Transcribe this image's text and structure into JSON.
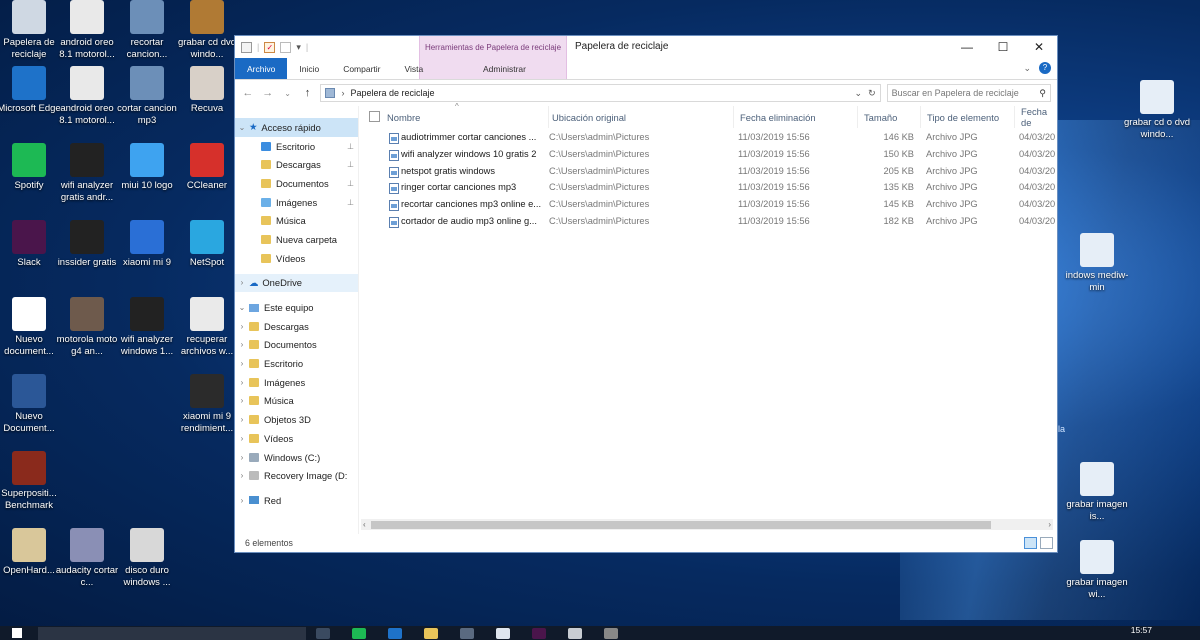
{
  "desktop": {
    "icons": [
      {
        "label": "Papelera de reciclaje",
        "icon": "recycle-bin-icon",
        "color": "#cfd8e3"
      },
      {
        "label": "android oreo 8.1 motorol...",
        "icon": "document-icon",
        "color": "#e9e9e9"
      },
      {
        "label": "recortar cancion...",
        "icon": "image-icon",
        "color": "#6c8fb8"
      },
      {
        "label": "grabar cd dvd windo...",
        "icon": "image-icon",
        "color": "#b07a34"
      },
      {
        "label": "Microsoft Edge",
        "icon": "edge-icon",
        "color": "#1e72c9"
      },
      {
        "label": "android oreo 8.1 motorol...",
        "icon": "document-icon",
        "color": "#e9e9e9"
      },
      {
        "label": "cortar cancion mp3",
        "icon": "image-icon",
        "color": "#6c8fb8"
      },
      {
        "label": "Recuva",
        "icon": "recuva-icon",
        "color": "#d8d0c8"
      },
      {
        "label": "Spotify",
        "icon": "spotify-icon",
        "color": "#1db954"
      },
      {
        "label": "wifi analyzer gratis andr...",
        "icon": "image-icon",
        "color": "#222"
      },
      {
        "label": "miui 10 logo",
        "icon": "image-icon",
        "color": "#3ea3f0"
      },
      {
        "label": "CCleaner",
        "icon": "ccleaner-icon",
        "color": "#d6302b"
      },
      {
        "label": "Slack",
        "icon": "slack-icon",
        "color": "#4a154b"
      },
      {
        "label": "inssider gratis",
        "icon": "image-icon",
        "color": "#222"
      },
      {
        "label": "xiaomi mi 9",
        "icon": "image-icon",
        "color": "#2a6fd6"
      },
      {
        "label": "NetSpot",
        "icon": "netspot-icon",
        "color": "#2aa7e0"
      },
      {
        "label": "Nuevo document...",
        "icon": "document-icon",
        "color": "#ffffff"
      },
      {
        "label": "motorola moto g4 an...",
        "icon": "image-icon",
        "color": "#6e5a4c"
      },
      {
        "label": "wifi analyzer windows 1...",
        "icon": "image-icon",
        "color": "#222"
      },
      {
        "label": "recuperar archivos w...",
        "icon": "image-icon",
        "color": "#eaeaea"
      },
      {
        "label": "Nuevo Document...",
        "icon": "word-icon",
        "color": "#2b5797"
      },
      {
        "label": "xiaomi mi 9 rendimient...",
        "icon": "image-icon",
        "color": "#2b2b2b"
      },
      {
        "label": "Superpositi... Benchmark",
        "icon": "benchmark-icon",
        "color": "#8a2a1c"
      },
      {
        "label": "OpenHard...",
        "icon": "openhardware-icon",
        "color": "#d9c79a"
      },
      {
        "label": "audacity cortar c...",
        "icon": "image-icon",
        "color": "#8a8fb5"
      },
      {
        "label": "disco duro windows ...",
        "icon": "image-icon",
        "color": "#d8d8d8"
      },
      {
        "label": "grabar cd o dvd windo...",
        "icon": "image-icon",
        "color": "#e6eef7"
      },
      {
        "label": "indows mediw-min",
        "icon": "image-icon",
        "color": "#e6eef7"
      },
      {
        "label": "grabar imagen is...",
        "icon": "image-icon",
        "color": "#e6eef7"
      },
      {
        "label": "grabar imagen wi...",
        "icon": "image-icon",
        "color": "#e6eef7"
      }
    ],
    "edge_text": "la"
  },
  "window": {
    "title": "Papelera de reciclaje",
    "contextual_tab_title": "Herramientas de Papelera de reciclaje",
    "controls": {
      "minimize": "—",
      "maximize": "☐",
      "close": "✕"
    },
    "ribbon_tabs": [
      "Archivo",
      "Inicio",
      "Compartir",
      "Vista"
    ],
    "admin_tab": "Administrar",
    "help": "?",
    "address": {
      "path": "Papelera de reciclaje",
      "search_placeholder": "Buscar en Papelera de reciclaje"
    },
    "nav": {
      "quick_access": "Acceso rápido",
      "quick_items": [
        "Escritorio",
        "Descargas",
        "Documentos",
        "Imágenes",
        "Música",
        "Nueva carpeta",
        "Vídeos"
      ],
      "onedrive": "OneDrive",
      "this_pc": "Este equipo",
      "pc_items": [
        "Descargas",
        "Documentos",
        "Escritorio",
        "Imágenes",
        "Música",
        "Objetos 3D",
        "Vídeos",
        "Windows (C:)",
        "Recovery Image (D:"
      ],
      "network": "Red"
    },
    "columns": [
      "Nombre",
      "Ubicación original",
      "Fecha eliminación",
      "Tamaño",
      "Tipo de elemento",
      "Fecha de"
    ],
    "files": [
      {
        "name": "audiotrimmer cortar canciones ...",
        "location": "C:\\Users\\admin\\Pictures",
        "deleted": "11/03/2019 15:56",
        "size": "146 KB",
        "type": "Archivo JPG",
        "date": "04/03/20"
      },
      {
        "name": "wifi analyzer windows 10 gratis 2",
        "location": "C:\\Users\\admin\\Pictures",
        "deleted": "11/03/2019 15:56",
        "size": "150 KB",
        "type": "Archivo JPG",
        "date": "04/03/20"
      },
      {
        "name": "netspot gratis windows",
        "location": "C:\\Users\\admin\\Pictures",
        "deleted": "11/03/2019 15:56",
        "size": "205 KB",
        "type": "Archivo JPG",
        "date": "04/03/20"
      },
      {
        "name": "ringer cortar canciones mp3",
        "location": "C:\\Users\\admin\\Pictures",
        "deleted": "11/03/2019 15:56",
        "size": "135 KB",
        "type": "Archivo JPG",
        "date": "04/03/20"
      },
      {
        "name": "recortar canciones mp3 online e...",
        "location": "C:\\Users\\admin\\Pictures",
        "deleted": "11/03/2019 15:56",
        "size": "145 KB",
        "type": "Archivo JPG",
        "date": "04/03/20"
      },
      {
        "name": "cortador de audio mp3 online g...",
        "location": "C:\\Users\\admin\\Pictures",
        "deleted": "11/03/2019 15:56",
        "size": "182 KB",
        "type": "Archivo JPG",
        "date": "04/03/20"
      }
    ],
    "status": "6 elementos"
  },
  "taskbar": {
    "clock": "15:57"
  },
  "colors": {
    "accent": "#1a6ac4",
    "selection": "#cce4f7",
    "contextual": "#f0dcf0"
  }
}
